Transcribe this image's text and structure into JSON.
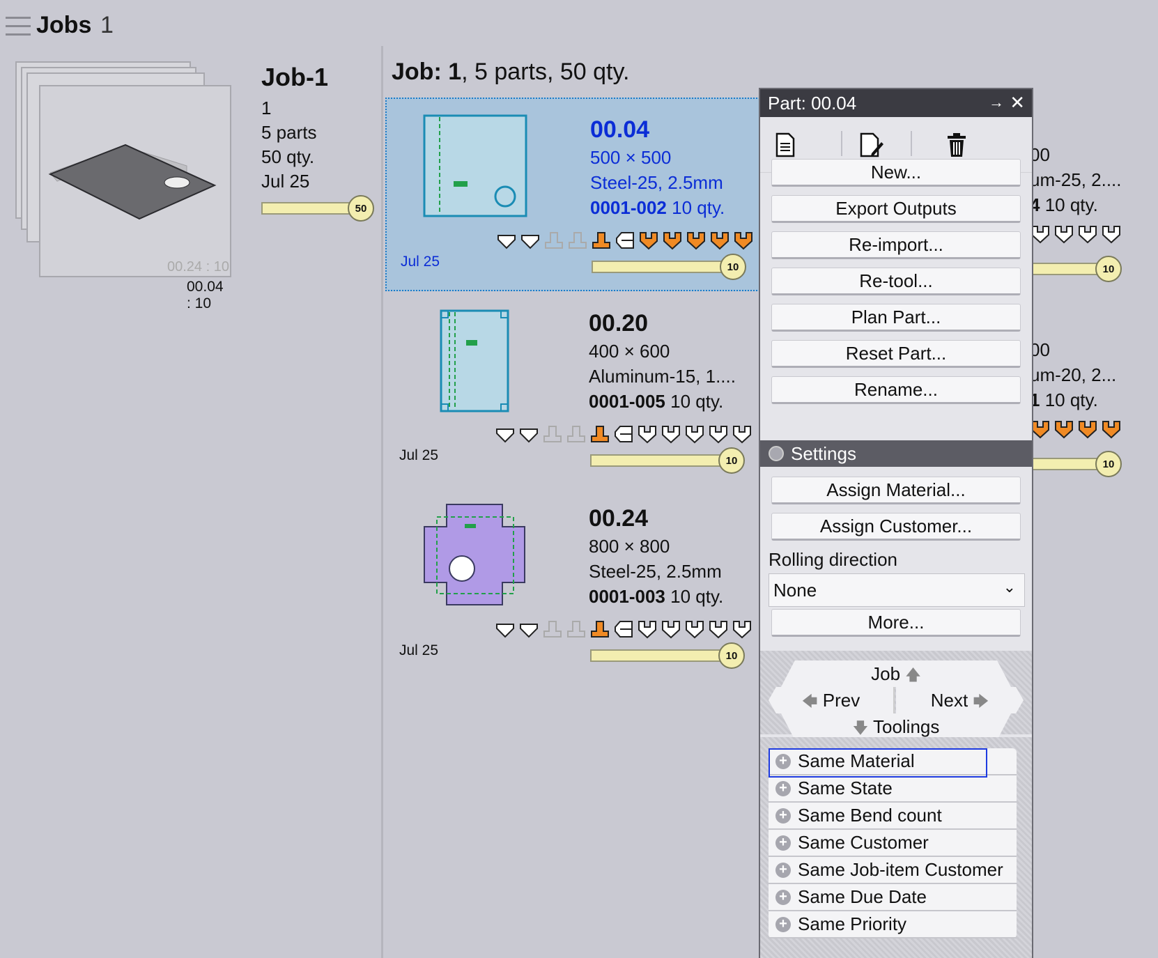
{
  "header": {
    "title": "Jobs",
    "count": "1"
  },
  "job_summary": {
    "name": "Job-1",
    "line1": "1",
    "parts": "5 parts",
    "qty": "50 qty.",
    "date": "Jul 25",
    "progress_value": "50",
    "thumb_ghost_label": "00.24 : 10",
    "thumb_label": "00.04 : 10"
  },
  "job_heading": {
    "bold": "Job: 1",
    "rest": ", 5 parts, 50 qty."
  },
  "parts": [
    {
      "number": "00.04",
      "size": "500 × 500",
      "material": "Steel-25, 2.5mm",
      "code": "0001-002",
      "qty": "10 qty.",
      "date": "Jul 25",
      "progress": "10",
      "selected": true,
      "highlight_color": "#0b2dd6"
    },
    {
      "number": "00.20",
      "size": "400 × 600",
      "material": "Aluminum-15, 1....",
      "code": "0001-005",
      "qty": "10 qty.",
      "date": "Jul 25",
      "progress": "10",
      "selected": false
    },
    {
      "number": "00.24",
      "size": "800 × 800",
      "material": "Steel-25, 2.5mm",
      "code": "0001-003",
      "qty": "10 qty.",
      "date": "Jul 25",
      "progress": "10",
      "selected": false
    }
  ],
  "ghost_column": {
    "row1": {
      "number": "00",
      "material": "um-25, 2....",
      "code": "4",
      "qty": "10 qty.",
      "progress": "10"
    },
    "row2": {
      "number": "00",
      "material": "um-20, 2...",
      "code": "1",
      "qty": "10 qty.",
      "progress": "10"
    }
  },
  "panel": {
    "title_bold": "Part:",
    "title_value": " 00.04",
    "toolbar_icons": [
      "document-icon",
      "edit-document-icon",
      "trash-icon"
    ],
    "buttons": [
      "New...",
      "Export Outputs",
      "Re-import...",
      "Re-tool...",
      "Plan Part...",
      "Reset Part...",
      "Rename..."
    ],
    "settings_label": "Settings",
    "settings_buttons": [
      "Assign Material...",
      "Assign Customer..."
    ],
    "rolling_label": "Rolling direction",
    "rolling_value": "None",
    "more_button": "More...",
    "nav": {
      "job": "Job",
      "prev": "Prev",
      "next": "Next",
      "toolings": "Toolings"
    },
    "filters": [
      "Same Material",
      "Same State",
      "Same Bend count",
      "Same Customer",
      "Same Job-item Customer",
      "Same Due Date",
      "Same Priority"
    ]
  },
  "colors": {
    "accent": "#0b2dd6",
    "tool_orange": "#f08a24",
    "progress_fill": "#f3eeb0",
    "panel_title_bg": "#3b3b42"
  }
}
